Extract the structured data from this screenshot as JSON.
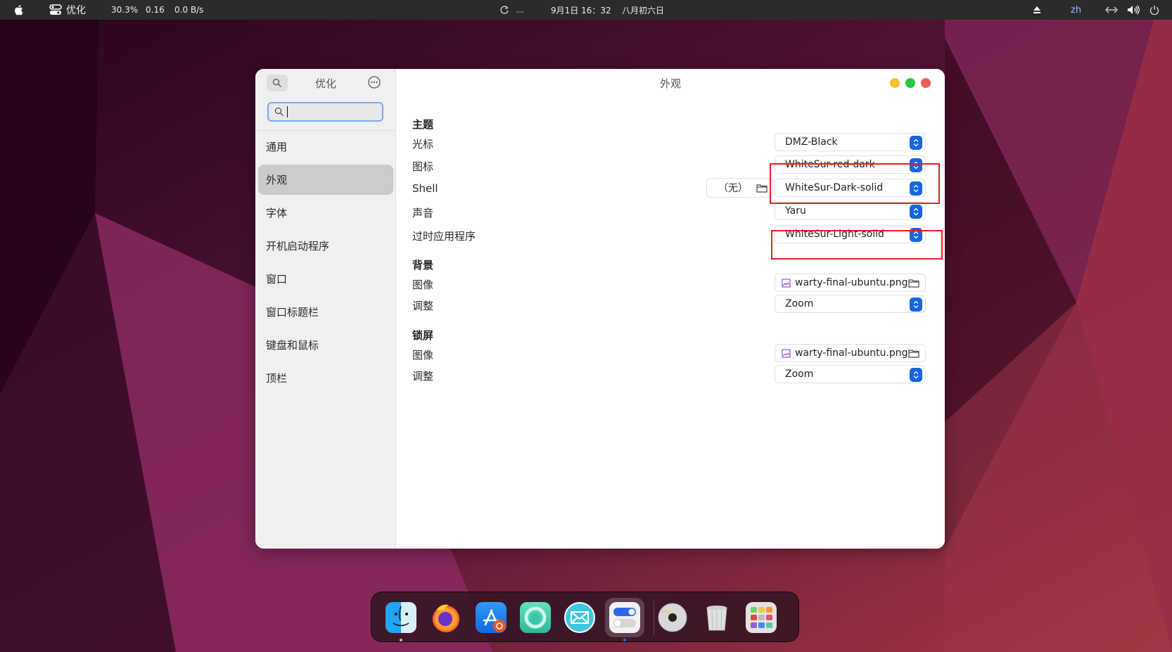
{
  "topbar": {
    "app_name": "优化",
    "cpu": "30.3%",
    "load": "0.16",
    "net": "0.0 B/s",
    "refresh_text": "...",
    "datetime": "9月1日  16：32",
    "lunar": "八月初六日",
    "input_method": "zh",
    "icons": [
      "apple-icon",
      "tweaks-icon",
      "refresh-icon",
      "eject-icon",
      "network-icon",
      "volume-icon",
      "power-icon"
    ]
  },
  "window": {
    "sidebar": {
      "title": "优化",
      "search_value": "",
      "items": [
        {
          "label": "通用",
          "active": false
        },
        {
          "label": "外观",
          "active": true
        },
        {
          "label": "字体",
          "active": false
        },
        {
          "label": "开机启动程序",
          "active": false
        },
        {
          "label": "窗口",
          "active": false
        },
        {
          "label": "窗口标题栏",
          "active": false
        },
        {
          "label": "键盘和鼠标",
          "active": false
        },
        {
          "label": "顶栏",
          "active": false
        }
      ]
    },
    "main": {
      "title": "外观",
      "colors": {
        "minimize": "#f5c12c",
        "maximize": "#27c840",
        "close": "#f25a52",
        "accent": "#1565e0",
        "highlight": "#ee1c1c"
      },
      "sections": {
        "theme": {
          "heading": "主题",
          "cursor_label": "光标",
          "cursor_value": "DMZ-Black",
          "icons_label": "图标",
          "icons_value": "WhiteSur-red-dark",
          "shell_label": "Shell",
          "shell_file": "（无）",
          "shell_value": "WhiteSur-Dark-solid",
          "sound_label": "声音",
          "sound_value": "Yaru",
          "legacy_label": "过时应用程序",
          "legacy_value": "WhiteSur-Light-solid"
        },
        "background": {
          "heading": "背景",
          "image_label": "图像",
          "image_value": "warty-final-ubuntu.png",
          "adjust_label": "调整",
          "adjust_value": "Zoom"
        },
        "lockscreen": {
          "heading": "锁屏",
          "image_label": "图像",
          "image_value": "warty-final-ubuntu.png",
          "adjust_label": "调整",
          "adjust_value": "Zoom"
        }
      }
    }
  },
  "dock": {
    "apps": [
      "Finder",
      "Firefox",
      "App Store",
      "Help",
      "Mail",
      "Tweaks",
      "Disc",
      "Trash",
      "Launchpad"
    ],
    "running": [
      "Finder",
      "Tweaks"
    ]
  }
}
